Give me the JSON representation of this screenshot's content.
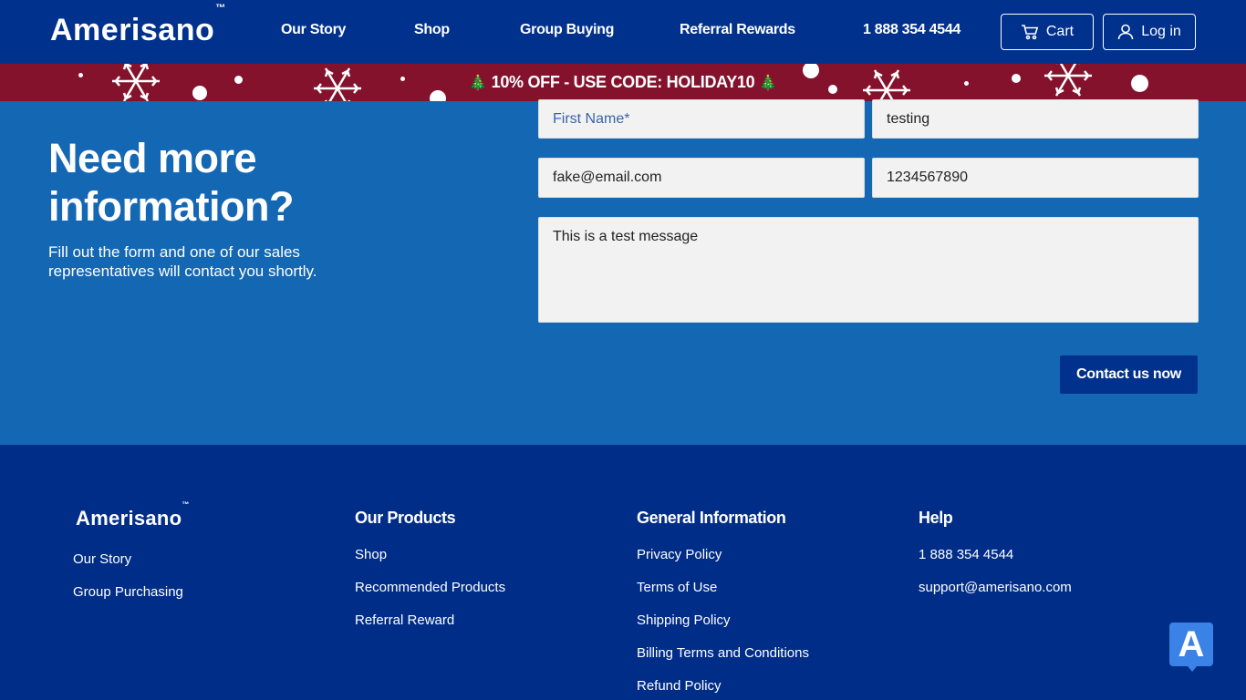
{
  "header": {
    "logo": "Amerisano",
    "logo_tm": "™",
    "nav": [
      "Our Story",
      "Shop",
      "Group Buying",
      "Referral Rewards"
    ],
    "phone": "1 888 354 4544",
    "cart_label": "Cart",
    "login_label": "Log in"
  },
  "promo": {
    "tree_icon": "🎄",
    "text": "10% OFF - USE CODE: HOLIDAY10"
  },
  "contact": {
    "title": "Need more information?",
    "subtitle": "Fill out the form and one of our sales representatives will contact you shortly.",
    "first_name_placeholder": "First Name*",
    "last_name_value": "testing",
    "email_value": "fake@email.com",
    "phone_value": "1234567890",
    "message_value": "This is a test message",
    "submit_label": "Contact us now"
  },
  "footer": {
    "logo": "Amerisano",
    "logo_tm": "™",
    "col1_links": [
      "Our Story",
      "Group Purchasing"
    ],
    "col2_title": "Our Products",
    "col2_links": [
      "Shop",
      "Recommended Products",
      "Referral Reward"
    ],
    "col3_title": "General Information",
    "col3_links": [
      "Privacy Policy",
      "Terms of Use",
      "Shipping Policy",
      "Billing Terms and Conditions",
      "Refund Policy"
    ],
    "col4_title": "Help",
    "col4_links": [
      "1 888 354 4544",
      "support@amerisano.com"
    ]
  },
  "chat": {
    "label": "A"
  },
  "colors": {
    "header_bg": "#00318c",
    "promo_bg": "#84122d",
    "contact_bg": "#1467b3",
    "footer_bg": "#002d87",
    "chat_bg": "#3b82e6"
  }
}
